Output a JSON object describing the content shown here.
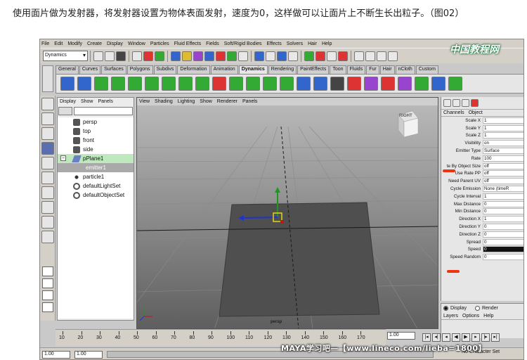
{
  "caption": "使用面片做为发射器，将发射器设置为物体表面发射，速度为0，这样做可以让面片上不断生长出粒子。（图02）",
  "menubar": [
    "File",
    "Edit",
    "Modify",
    "Create",
    "Display",
    "Window",
    "Particles",
    "Fluid Effects",
    "Fields",
    "Soft/Rigid Bodies",
    "Effects",
    "Solvers",
    "Hair",
    "Help"
  ],
  "mode_selector": "Dynamics",
  "shelf_tabs": [
    "General",
    "Curves",
    "Surfaces",
    "Polygons",
    "Subdivs",
    "Deformation",
    "Animation",
    "Dynamics",
    "Rendering",
    "PaintEffects",
    "Toon",
    "Fluids",
    "Fur",
    "Hair",
    "nCloth",
    "Custom"
  ],
  "active_shelf_tab": "Dynamics",
  "outliner": {
    "menu": [
      "Display",
      "Show",
      "Panels"
    ],
    "items": [
      {
        "label": "persp",
        "type": "cam"
      },
      {
        "label": "top",
        "type": "cam"
      },
      {
        "label": "front",
        "type": "cam"
      },
      {
        "label": "side",
        "type": "cam"
      },
      {
        "label": "pPlane1",
        "type": "plane",
        "selected": true,
        "toggle": "−"
      },
      {
        "label": "emitter1",
        "type": "child"
      },
      {
        "label": "particle1",
        "type": "part"
      },
      {
        "label": "defaultLightSet",
        "type": "set"
      },
      {
        "label": "defaultObjectSet",
        "type": "set"
      }
    ]
  },
  "viewport": {
    "menu": [
      "View",
      "Shading",
      "Lighting",
      "Show",
      "Renderer",
      "Panels"
    ],
    "camera_label": "persp",
    "viewcube_label": "RIGHT"
  },
  "channel_box": {
    "menu": [
      "Channels",
      "Object"
    ],
    "attributes": [
      {
        "name": "Scale X",
        "value": "1"
      },
      {
        "name": "Scale Y",
        "value": "1"
      },
      {
        "name": "Scale Z",
        "value": "1"
      },
      {
        "name": "Visibility",
        "value": "on"
      },
      {
        "name": "Emitter Type",
        "value": "Surface"
      },
      {
        "name": "Rate",
        "value": "100"
      },
      {
        "name": "te By Object Size",
        "value": "off"
      },
      {
        "name": "Use Rate PP",
        "value": "off"
      },
      {
        "name": "Need Parent UV",
        "value": "off"
      },
      {
        "name": "Cycle Emission",
        "value": "None (timeR"
      },
      {
        "name": "Cycle Interval",
        "value": "1"
      },
      {
        "name": "Max Distance",
        "value": "0"
      },
      {
        "name": "Min Distance",
        "value": "0"
      },
      {
        "name": "Direction X",
        "value": "1"
      },
      {
        "name": "Direction Y",
        "value": "0"
      },
      {
        "name": "Direction Z",
        "value": "0"
      },
      {
        "name": "Spread",
        "value": "0"
      },
      {
        "name": "Speed",
        "value": "0",
        "highlight": true
      },
      {
        "name": "Speed Random",
        "value": "0"
      }
    ]
  },
  "layer_panel": {
    "display": "Display",
    "render": "Render",
    "menu": [
      "Layers",
      "Options",
      "Help"
    ]
  },
  "time_slider": {
    "ticks": [
      "10",
      "20",
      "30",
      "40",
      "50",
      "60",
      "70",
      "80",
      "90",
      "100",
      "110",
      "120",
      "130",
      "140",
      "150",
      "160",
      "170"
    ],
    "current_frame": "1.00"
  },
  "range": {
    "start": "1.00",
    "inner_start": "1.00"
  },
  "character_set": "No Character Set",
  "watermark": "MAYA学习吧—【www.lineco.com/lieba=1800】",
  "logo": "中国教程网"
}
